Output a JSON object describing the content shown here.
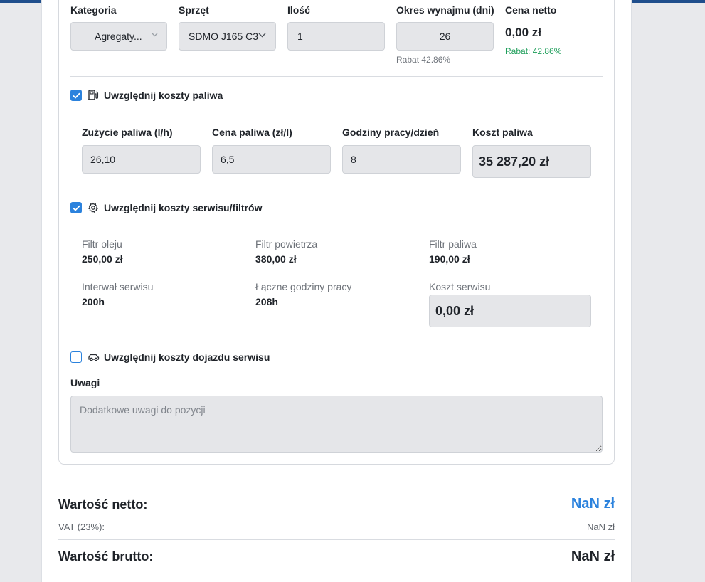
{
  "item": {
    "category": {
      "label": "Kategoria",
      "value": "Agregaty..."
    },
    "equipment": {
      "label": "Sprzęt",
      "value": "SDMO J165 C3"
    },
    "quantity": {
      "label": "Ilość",
      "value": "1"
    },
    "rental_days": {
      "label": "Okres wynajmu (dni)",
      "value": "26",
      "discount_note": "Rabat 42.86%"
    },
    "net_price": {
      "label": "Cena netto",
      "value": "0,00 zł",
      "discount_note": "Rabat: 42.86%"
    }
  },
  "fuel": {
    "checkbox_label": "Uwzględnij koszty paliwa",
    "checked": true,
    "consumption": {
      "label": "Zużycie paliwa (l/h)",
      "value": "26,10"
    },
    "price": {
      "label": "Cena paliwa (zł/l)",
      "value": "6,5"
    },
    "hours": {
      "label": "Godziny pracy/dzień",
      "value": "8"
    },
    "cost": {
      "label": "Koszt paliwa",
      "value": "35 287,20 zł"
    }
  },
  "service": {
    "checkbox_label": "Uwzględnij koszty serwisu/filtrów",
    "checked": true,
    "oil_filter": {
      "label": "Filtr oleju",
      "value": "250,00 zł"
    },
    "air_filter": {
      "label": "Filtr powietrza",
      "value": "380,00 zł"
    },
    "fuel_filter": {
      "label": "Filtr paliwa",
      "value": "190,00 zł"
    },
    "interval": {
      "label": "Interwał serwisu",
      "value": "200h"
    },
    "total_hours": {
      "label": "Łączne godziny pracy",
      "value": "208h"
    },
    "cost": {
      "label": "Koszt serwisu",
      "value": "0,00 zł"
    }
  },
  "travel": {
    "checkbox_label": "Uwzględnij koszty dojazdu serwisu",
    "checked": false
  },
  "notes": {
    "label": "Uwagi",
    "placeholder": "Dodatkowe uwagi do pozycji",
    "value": ""
  },
  "summary": {
    "net_label": "Wartość netto:",
    "net_value": "NaN zł",
    "vat_label": "VAT (23%):",
    "vat_value": "NaN zł",
    "gross_label": "Wartość brutto:",
    "gross_value": "NaN zł"
  },
  "colors": {
    "accent": "#2b82dd",
    "discount_green": "#1e9e5a",
    "field_bg": "#e5e6e9",
    "header_bar": "#1f4e8c"
  },
  "icons": {
    "select_arrow": "chevron-down-icon",
    "fuel": "fuel-pump-icon",
    "service": "gear-icon",
    "travel": "car-icon",
    "checkbox": "check-icon",
    "resize": "resize-handle-icon"
  }
}
